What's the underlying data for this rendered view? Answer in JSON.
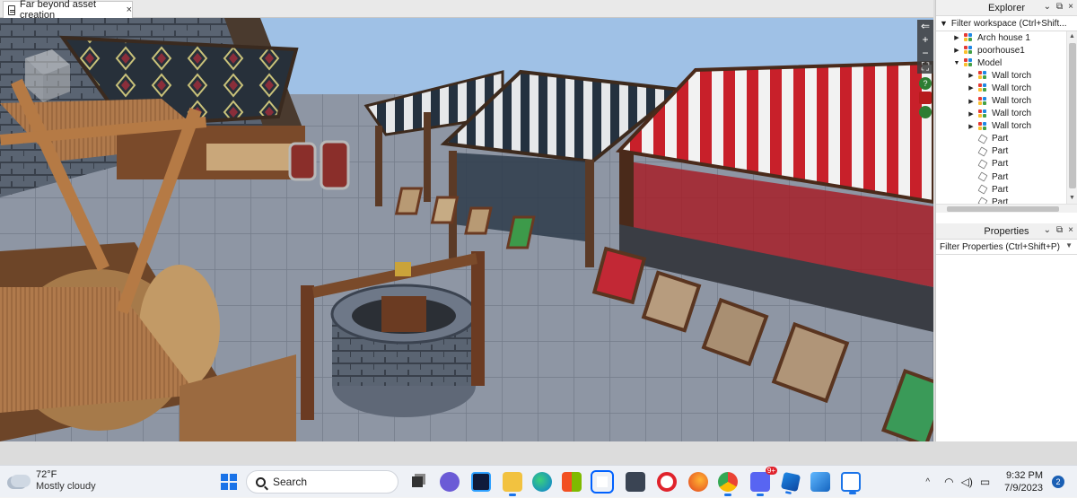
{
  "document_tab": {
    "title": "Far beyond asset creation",
    "close_glyph": "×"
  },
  "viewport_tools": {
    "collapse_glyph": "⇐",
    "zoom_in_glyph": "+",
    "zoom_out_glyph": "−",
    "fullscreen_glyph": "⛶"
  },
  "explorer": {
    "title": "Explorer",
    "filter_placeholder": "Filter workspace (Ctrl+Shift...",
    "items": [
      {
        "label": "Arch house 1",
        "indent": 1,
        "expander": "▶",
        "icon": "model-icon"
      },
      {
        "label": "poorhouse1",
        "indent": 1,
        "expander": "▶",
        "icon": "model-icon"
      },
      {
        "label": "Model",
        "indent": 1,
        "expander": "▼",
        "icon": "model-icon"
      },
      {
        "label": "Wall torch",
        "indent": 2,
        "expander": "▶",
        "icon": "model-icon"
      },
      {
        "label": "Wall torch",
        "indent": 2,
        "expander": "▶",
        "icon": "model-icon"
      },
      {
        "label": "Wall torch",
        "indent": 2,
        "expander": "▶",
        "icon": "model-icon"
      },
      {
        "label": "Wall torch",
        "indent": 2,
        "expander": "▶",
        "icon": "model-icon"
      },
      {
        "label": "Wall torch",
        "indent": 2,
        "expander": "▶",
        "icon": "model-icon"
      },
      {
        "label": "Part",
        "indent": 2,
        "expander": "",
        "icon": "part-icon"
      },
      {
        "label": "Part",
        "indent": 2,
        "expander": "",
        "icon": "part-icon"
      },
      {
        "label": "Part",
        "indent": 2,
        "expander": "",
        "icon": "part-icon"
      },
      {
        "label": "Part",
        "indent": 2,
        "expander": "",
        "icon": "part-icon"
      },
      {
        "label": "Part",
        "indent": 2,
        "expander": "",
        "icon": "part-icon"
      },
      {
        "label": "Part",
        "indent": 2,
        "expander": "",
        "icon": "part-icon"
      }
    ]
  },
  "properties": {
    "title": "Properties",
    "filter_placeholder": "Filter Properties (Ctrl+Shift+P)"
  },
  "panel_controls": {
    "chevron": "⌄",
    "float": "⧉",
    "close": "×"
  },
  "taskbar": {
    "weather_temp": "72°F",
    "weather_condition": "Mostly cloudy",
    "search_label": "Search",
    "tray_chevron": "^",
    "time": "9:32 PM",
    "date": "7/9/2023",
    "notification_count": "2",
    "discord_badge": "9+",
    "apps": [
      "task-view",
      "chat",
      "terminal",
      "file-explorer",
      "edge",
      "store",
      "dropbox",
      "game",
      "opera",
      "firefox",
      "chrome",
      "discord",
      "roblox",
      "photos",
      "roblox-studio"
    ]
  },
  "colors": {
    "accent": "#1a73e8",
    "awning_red": "#c8202a",
    "awning_navy": "#24313f",
    "sky": "#9fc1e6"
  }
}
